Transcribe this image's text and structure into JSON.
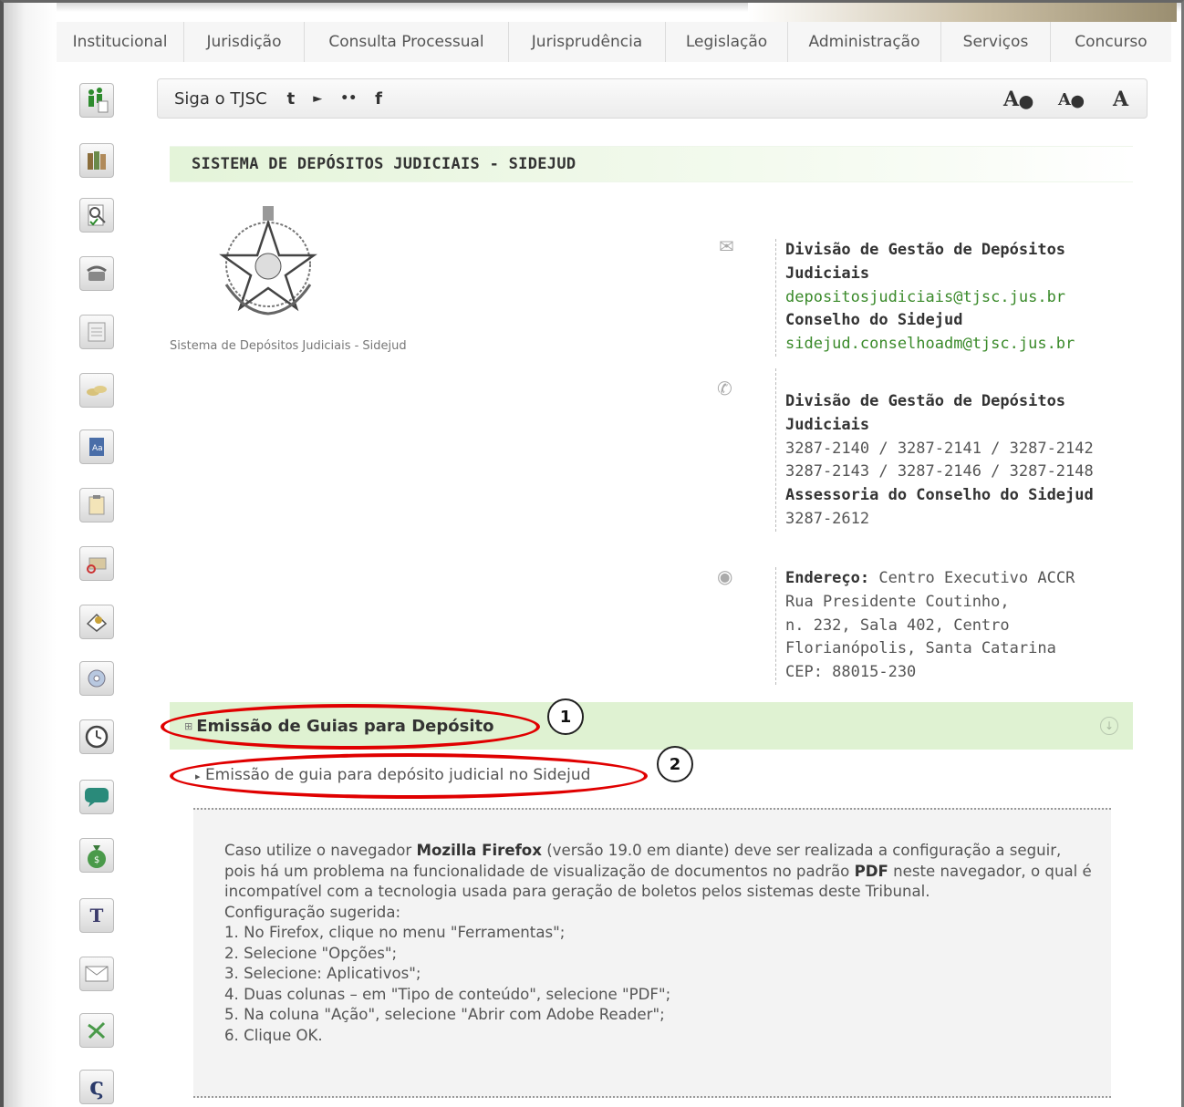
{
  "nav": {
    "tabs": [
      "Institucional",
      "Jurisdição",
      "Consulta Processual",
      "Jurisprudência",
      "Legislação",
      "Administração",
      "Serviços",
      "Concurso"
    ]
  },
  "sidebar": {
    "icons": [
      "family-icon",
      "books-icon",
      "magnifier-document-icon",
      "telephone-icon",
      "calendar-document-icon",
      "coins-icon",
      "dictionary-icon",
      "clipboard-icon",
      "mailbox-icon",
      "stamp-icon",
      "cd-icon",
      "clock-icon",
      "chat-bubble-icon",
      "money-bag-icon",
      "text-t-icon",
      "envelope-icon",
      "arrows-icon",
      "s-logo-icon"
    ]
  },
  "social": {
    "label": "Siga o TJSC",
    "links": [
      "t",
      "►",
      "••",
      "f"
    ],
    "font_controls": [
      "A+",
      "A−",
      "A"
    ]
  },
  "section": {
    "title": "SISTEMA DE DEPÓSITOS JUDICIAIS - SIDEJUD",
    "emblem_caption": "Sistema de Depósitos Judiciais - Sidejud"
  },
  "contact": {
    "email": {
      "division": "Divisão de Gestão de Depósitos Judiciais",
      "division_email": "depositosjudiciais@tjsc.jus.br",
      "council": "Conselho do Sidejud",
      "council_email": "sidejud.conselhoadm@tjsc.jus.br"
    },
    "phone": {
      "division": "Divisão de Gestão de Depósitos Judiciais",
      "division_phones_1": "3287-2140 / 3287-2141 / 3287-2142",
      "division_phones_2": "3287-2143 / 3287-2146 / 3287-2148",
      "council": "Assessoria do Conselho do Sidejud",
      "council_phone": "3287-2612"
    },
    "address": {
      "label": "Endereço:",
      "line1": "Centro Executivo ACCR",
      "line2": "Rua Presidente Coutinho,",
      "line3": "n. 232, Sala 402, Centro",
      "line4": "Florianópolis, Santa Catarina",
      "line5": "CEP: 88015-230"
    }
  },
  "accordion": {
    "title": "Emissão de Guias para Depósito",
    "link": "Emissão de guia para depósito judicial no Sidejud"
  },
  "callouts": [
    "1",
    "2"
  ],
  "notice": {
    "intro_a": "Caso utilize o navegador ",
    "browser": "Mozilla Firefox",
    "intro_b": " (versão 19.0 em diante) deve ser realizada a configuração a seguir, pois há um problema na funcionalidade de visualização de documentos no padrão ",
    "pdf": "PDF",
    "intro_c": " neste navegador, o qual é incompatível com a tecnologia usada para geração de boletos pelos sistemas deste Tribunal.",
    "config_label": "Configuração sugerida:",
    "steps": [
      "1. No Firefox, clique no menu \"Ferramentas\";",
      "2. Selecione \"Opções\";",
      "3. Selecione: Aplicativos\";",
      "4. Duas colunas – em \"Tipo de conteúdo\", selecione \"PDF\";",
      "5. Na coluna \"Ação\", selecione \"Abrir com Adobe Reader\";",
      "6. Clique OK."
    ]
  },
  "colors": {
    "accent_green": "#dff2d2",
    "link_green": "#3a8a2a",
    "annotation_red": "#e00000"
  }
}
